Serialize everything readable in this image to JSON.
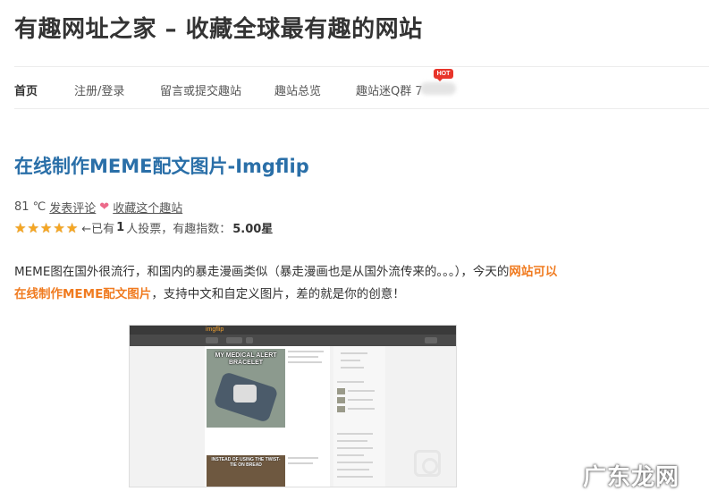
{
  "site": {
    "title": "有趣网址之家 – 收藏全球最有趣的网站"
  },
  "nav": {
    "items": [
      {
        "label": "首页",
        "active": true
      },
      {
        "label": "注册/登录"
      },
      {
        "label": "留言或提交趣站"
      },
      {
        "label": "趣站总览"
      },
      {
        "label": "趣站迷Q群 7"
      }
    ],
    "hot_badge": "HOT"
  },
  "post": {
    "title": "在线制作MEME配文图片-Imgflip",
    "temperature": "81 ℃",
    "comment_link": "发表评论",
    "favorite_link": "收藏这个趣站",
    "rating": {
      "stars": 5,
      "prefix": "←已有",
      "votes": "1",
      "middle": " 人投票，有趣指数：",
      "score": "5.00星"
    },
    "description": {
      "part1": "MEME图在国外很流行，和国内的暴走漫画类似（暴走漫画也是从国外流传来的。。。），今天的",
      "highlight": "网站可以在线制作MEME配文图片",
      "part2": "，支持中文和自定义图片，差的就是你的创意！"
    }
  },
  "embedded_screenshot": {
    "logo_prefix": "img",
    "logo_suffix": "flip",
    "meme1_caption": "MY MEDICAL ALERT BRACELET",
    "meme2_caption": "INSTEAD OF USING THE TWIST-TIE ON BREAD"
  },
  "watermark": "广东龙网",
  "colors": {
    "title_link": "#2a6fa8",
    "highlight": "#f07b20",
    "star": "#f5a623",
    "hot": "#e8352b"
  }
}
